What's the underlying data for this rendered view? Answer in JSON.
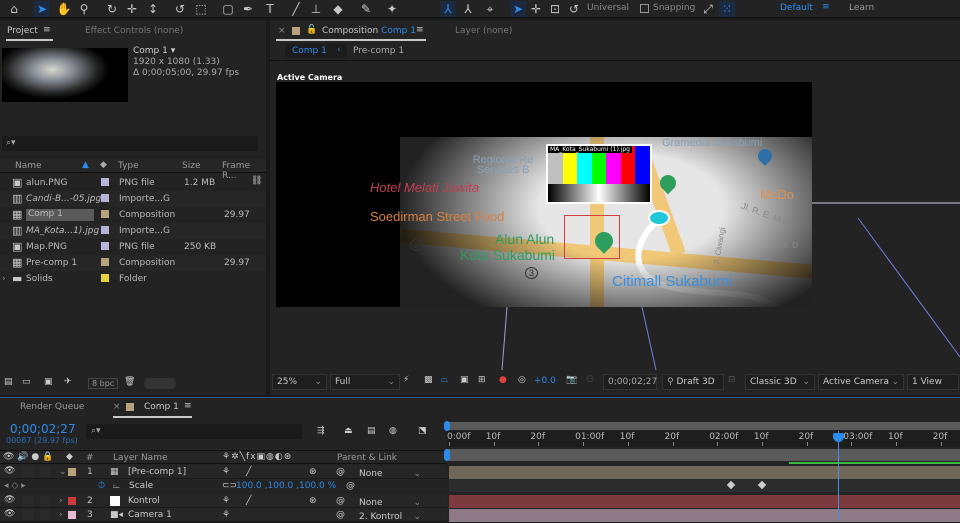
{
  "toolbar": {
    "tools": [
      "home-icon",
      "selection-icon",
      "hand-icon",
      "zoom-icon",
      "orbit-icon",
      "pan-icon",
      "dolly-icon",
      "rotate-icon",
      "anchor-icon",
      "rectangle-icon",
      "pen-icon",
      "type-icon",
      "brush-icon",
      "clone-stamp-icon",
      "eraser-icon",
      "roto-brush-icon",
      "puppet-pin-icon"
    ],
    "axis_mode": "Universal",
    "snapping": "Snapping",
    "workspace": "Default",
    "learn": "Learn"
  },
  "project": {
    "tab": "Project",
    "effect_controls": "Effect Controls (none)",
    "comp_name": "Comp 1",
    "resolution": "1920 x 1080 (1.33)",
    "duration": "Δ 0;00;05;00, 29.97 fps",
    "search_placeholder": "⌕▾",
    "columns": {
      "name": "Name",
      "type": "Type",
      "size": "Size",
      "frame_rate": "Frame R..."
    },
    "items": [
      {
        "name": "alun.PNG",
        "type": "PNG file",
        "size": "1.2 MB",
        "fps": "",
        "color": "#b4b4d8",
        "icon": "png-file-icon",
        "italic": false
      },
      {
        "name": "Candi-B...-05.jpg",
        "type": "Importe...G",
        "size": "",
        "fps": "",
        "color": "#b4b4d8",
        "icon": "image-file-icon",
        "italic": true
      },
      {
        "name": "Comp 1",
        "type": "Composition",
        "size": "",
        "fps": "29.97",
        "color": "#b8a27c",
        "icon": "composition-icon",
        "italic": false,
        "selected": true
      },
      {
        "name": "MA_Kota...1).jpg",
        "type": "Importe...G",
        "size": "",
        "fps": "",
        "color": "#b4b4d8",
        "icon": "image-file-icon",
        "italic": true
      },
      {
        "name": "Map.PNG",
        "type": "PNG file",
        "size": "250 KB",
        "fps": "",
        "color": "#b4b4d8",
        "icon": "png-file-icon",
        "italic": false
      },
      {
        "name": "Pre-comp 1",
        "type": "Composition",
        "size": "",
        "fps": "29.97",
        "color": "#b8a27c",
        "icon": "composition-icon",
        "italic": false
      },
      {
        "name": "Solids",
        "type": "Folder",
        "size": "",
        "fps": "",
        "color": "#e6d23c",
        "icon": "folder-icon",
        "italic": false
      }
    ],
    "bpc": "8 bpc"
  },
  "composition": {
    "tab_prefix": "Composition",
    "tab_comp": "Comp 1",
    "layer_tab": "Layer (none)",
    "breadcrumb": [
      "Comp 1",
      "Pre-comp 1"
    ],
    "view_label": "Active Camera",
    "map_labels": [
      "Regional Re Services B",
      "Hotel Melati Juwita",
      "Soedirman Street Food",
      "Alun Alun",
      "Kota Sukabumi",
      "Citimall Sukabumi",
      "McDo",
      "Jl. R. E. Mar",
      "Jl. Ciwangi",
      "Jl. D",
      "Gramedia Sukabumi",
      "3"
    ],
    "callout": "MA_Kota_Sukabumi (1).jpg",
    "bar": {
      "zoom": "25%",
      "resolution": "Full",
      "exposure": "+0.0",
      "timecode": "0;00;02;27",
      "renderer": "Draft 3D",
      "render_mode": "Classic 3D",
      "view": "Active Camera",
      "layout": "1 View"
    }
  },
  "timeline": {
    "render_queue": "Render Queue",
    "comp_tab": "Comp 1",
    "timecode": "0;00;02;27",
    "frame": "00087 (29.97 fps)",
    "search_placeholder": "⌕▾",
    "headers": {
      "num": "#",
      "layer_name": "Layer Name",
      "parent": "Parent & Link"
    },
    "ruler": [
      "0:00f",
      "10f",
      "20f",
      "01:00f",
      "10f",
      "20f",
      "02:00f",
      "10f",
      "20f",
      "03:00f",
      "10f",
      "20f"
    ],
    "playhead_frame": 87,
    "fps": 29.97,
    "keyframes": [
      63,
      70
    ],
    "layers": [
      {
        "num": "1",
        "name": "[Pre-comp 1]",
        "parent": "None",
        "label": "#b8a27c",
        "bar": "#6f6757",
        "icon": "precomp-icon"
      },
      {
        "num": "2",
        "name": "Kontrol",
        "parent": "None",
        "label": "#c83c3c",
        "bar": "#7a3a3e",
        "icon": "solid-icon"
      },
      {
        "num": "3",
        "name": "Camera 1",
        "parent": "2. Kontrol",
        "label": "#e8bcd0",
        "bar": "#8e7a86",
        "icon": "camera-icon"
      }
    ],
    "scale": {
      "label": "Scale",
      "value": "100.0 ,100.0 ,100.0 %"
    }
  }
}
